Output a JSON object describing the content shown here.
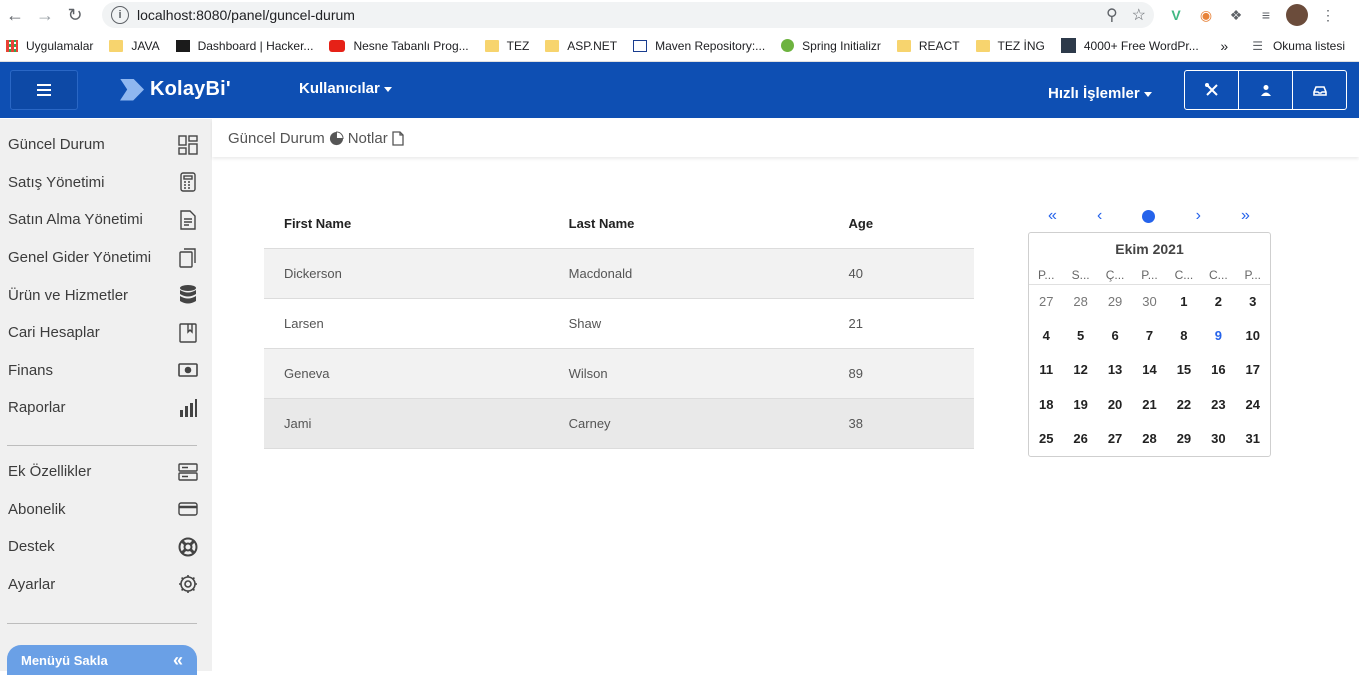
{
  "browser": {
    "url": "localhost:8080/panel/guncel-durum",
    "bookmarks": [
      {
        "label": "Uygulamalar",
        "kind": "apps"
      },
      {
        "label": "JAVA",
        "kind": "folder"
      },
      {
        "label": "Dashboard | Hacker...",
        "kind": "site"
      },
      {
        "label": "Nesne Tabanlı Prog...",
        "kind": "youtube"
      },
      {
        "label": "TEZ",
        "kind": "folder"
      },
      {
        "label": "ASP.NET",
        "kind": "folder"
      },
      {
        "label": "Maven Repository:...",
        "kind": "site"
      },
      {
        "label": "Spring Initializr",
        "kind": "site"
      },
      {
        "label": "REACT",
        "kind": "folder"
      },
      {
        "label": "TEZ İNG",
        "kind": "folder"
      },
      {
        "label": "4000+ Free WordPr...",
        "kind": "site"
      }
    ],
    "more_bookmarks": "»",
    "reading_list": "Okuma listesi"
  },
  "header": {
    "logo_text": "KolayBi'",
    "users_menu": "Kullanıcılar",
    "quick_actions": "Hızlı İşlemler"
  },
  "sidebar": {
    "items": [
      {
        "label": "Güncel Durum",
        "icon": "dashboard-icon"
      },
      {
        "label": "Satış Yönetimi",
        "icon": "calculator-icon"
      },
      {
        "label": "Satın Alma Yönetimi",
        "icon": "document-icon"
      },
      {
        "label": "Genel Gider Yönetimi",
        "icon": "copy-icon"
      },
      {
        "label": "Ürün ve Hizmetler",
        "icon": "database-icon"
      },
      {
        "label": "Cari Hesaplar",
        "icon": "book-icon"
      },
      {
        "label": "Finans",
        "icon": "money-icon"
      },
      {
        "label": "Raporlar",
        "icon": "bar-chart-icon"
      }
    ],
    "extra_items": [
      {
        "label": "Ek Özellikler",
        "icon": "server-icon"
      },
      {
        "label": "Abonelik",
        "icon": "credit-card-icon"
      },
      {
        "label": "Destek",
        "icon": "lifebuoy-icon"
      },
      {
        "label": "Ayarlar",
        "icon": "gear-icon"
      }
    ],
    "hide_menu_label": "Menüyü Sakla"
  },
  "breadcrumb": {
    "current": "Güncel Durum",
    "notes": "Notlar"
  },
  "table": {
    "columns": [
      "First Name",
      "Last Name",
      "Age"
    ],
    "rows": [
      [
        "Dickerson",
        "Macdonald",
        "40"
      ],
      [
        "Larsen",
        "Shaw",
        "21"
      ],
      [
        "Geneva",
        "Wilson",
        "89"
      ],
      [
        "Jami",
        "Carney",
        "38"
      ]
    ]
  },
  "calendar": {
    "title": "Ekim 2021",
    "weekdays": [
      "P...",
      "S...",
      "Ç...",
      "P...",
      "C...",
      "C...",
      "P..."
    ],
    "weeks": [
      [
        "27",
        "28",
        "29",
        "30",
        "1",
        "2",
        "3"
      ],
      [
        "4",
        "5",
        "6",
        "7",
        "8",
        "9",
        "10"
      ],
      [
        "11",
        "12",
        "13",
        "14",
        "15",
        "16",
        "17"
      ],
      [
        "18",
        "19",
        "20",
        "21",
        "22",
        "23",
        "24"
      ],
      [
        "25",
        "26",
        "27",
        "28",
        "29",
        "30",
        "31"
      ]
    ],
    "muted_first_week": [
      "27",
      "28",
      "29",
      "30"
    ],
    "today": "9",
    "accent_color": "#2563eb"
  },
  "colors": {
    "header_bg": "#0e4fb3",
    "sidebar_bg": "#f0f0f0",
    "hide_menu_bg": "#6aa0e6"
  }
}
